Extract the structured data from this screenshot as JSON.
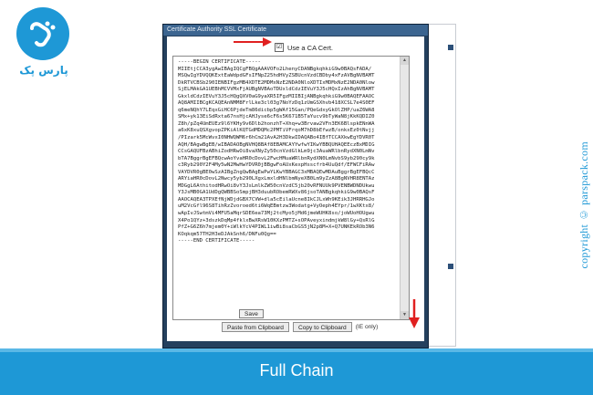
{
  "brand": {
    "name": "پارس پک",
    "color": "#1e98d6"
  },
  "watermark": "copyright © parspack.com",
  "window": {
    "title": "Certificate Authority SSL Certificate",
    "use_ca_checked": "☑",
    "use_ca_label": "Use a CA Cert.",
    "certificate_text": "-----BEGIN CERTIFICATE-----\nMIIEtjCCA3ygAwIBAgIQCgFBQgAAAVOFo2LhenyCDANBgkqhkiG9w0BAQsFADA/\nMSQwIgYDVQQKExtEaWdpdGFsIFNpZ25hdHVyZSBUcnVzdCBDby4xFzAVBgNVBAMT\nDkRTVCBSb290IENBIFgzMB4XDTE2MDMxNzE2NDA0NloXDTIxMDMxNzE2NDA0Nlow\nSjELMAkGA1UEBhMCVVMxFjAUBgNVBAoTDUxldCdzIEVuY3J5cHQxIzAhBgNVBAMT\nGkxldCdzIEVuY3J5cHQgQXV0aG9yaXR5IFgzMIIBIjANBgkqhkiG9w0BAQEFAAOC\nAQ8AMIIBCgKCAQEAnNMM8FrlLke3cl03g7NoYzDq1zUmGSXhvb418XCSL7e4S0EF\nq6meNQhY7LEqxGiHC6PjdeTm86dicbp5gWAf15Gan/PQeGdxyGkOlZHP/uaZ6WA8\nSMx+yk13EiSdRxta67nsHjcAHJyse6cF6s5K671B5TaYucv9bTyWaN8jKkKQDIZ0\nZ8h/pZq4UmEUEz9l6YKHy9v6Dlb2honzhT+Xhq+w3Brvaw2VFn3EK6BlspkENnWA\na6xK8xuQSXgvopZPKiAlKQTGdMDQMc2PMTiVFrqoM7hD8bEfwzB/onkxEz0tNvjj\n/PIzark5McWvxI0NHWQWM6r6hCm21AvA2H3DkwIDAQABo4IBfTCCAXkwEgYDVR0T\nAQH/BAgwBgEB/wIBADAOBgNVHQ8BAf8EBAMCAYYwfwYIKwYBBQUHAQEEczBxMDIG\nCCsGAQUFBzABhiZodHRwOi8vaXNyZy50cnVzdGlkLm9jc3AuaWRlbnRydXN0LmNv\nbTA7BggrBgEFBQcwAoYvaHR0cDovL2FwcHMuaWRlbnRydXN0LmNvbS9yb290cy9k\nc3Ryb290Y2F4My5wN2MwHwYDVR0jBBgwFoAUxKexpHsscfrb4UuQdf/EFWCFiRAw\nVAYDVR0gBE0wSzAIBgZngQwBAgEwPwYLKwYBBAGC3xMBAQEwMDAuBggrBgEFBQcC\nARYiaHR0cDovL2Nwcy5yb290LXgxLmxldHNlbmNyeXB0Lm9yZzA8BgNVHR8ENTAz\nMDGgL6AthitodHRwOi8vY3JsLmlkZW50cnVzdC5jb20vRFNUUk9PVENBWDNDUkwu\nY3JsMB0GA1UdDgQWBBSoSmpjBH3duubRObemRWXv86jsoTANBgkqhkiG9w0BAQsF\nAAOCAQEA3TPXEfNjWDjdGBX7CVW+dla5cEilaUcne8IkCJLxWh9KEik3JHRRHGJo\nuM2VcGfl96S8TihRzZvoroed6ti6WqEBmtzw3Wodatg+VyOeph4EYpr/1wXKtx8/\nwApIvJSwtmVi4MFU5aMqrSDE6ea73Mj2tcMyo5jMd6jmeWUHK8so/joWUoHOUgwu\nX4Po1QYz+3dszkDqMp4fklxBwXRsW10KXzPMTZ+sOPAveyxindmjkW8lGy+QsRlG\nPfZ+G6Z6h7mjem0Y+iWlkYcV4PIWL1iwBi8saCbGS5jN2p8M+X+Q7UNKEkROb3N6\nKOqkqm57TH2H3eDJAkSnh6/DNFu0Qg==\n-----END CERTIFICATE-----",
    "paste_button": "Paste from Clipboard",
    "copy_button": "Copy to Clipboard",
    "ie_only_note": "(IE only)",
    "save_button": "Save"
  },
  "footer": {
    "title": "Full Chain"
  },
  "colors": {
    "accent": "#1e98d6",
    "window_frame": "#24405e",
    "titlebar": "#3c6590",
    "arrow": "#e02020"
  }
}
